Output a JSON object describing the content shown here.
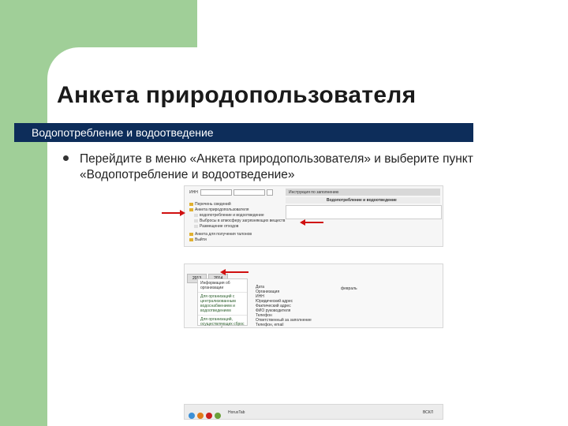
{
  "slide": {
    "title": "Анкета природопользователя",
    "section_bar": "Водопотребление и водоотведение",
    "bullet_text": "Перейдите в меню «Анкета природопользователя» и выберите пункт «Водопотребление и водоотведение»"
  },
  "screenshot_top": {
    "field_label": "ИНН",
    "instruction_link": "Инструкция по заполнению",
    "panel_header": "Водопотребление и водоотведение",
    "tree": [
      "Перечень сведений",
      "Анкета природопользователя",
      "водопотребление и водоотведение",
      "Выбросы в атмосферу загрязняющих веществ",
      "Размещение отходов",
      "Анкета для получения талонов",
      "Выйти"
    ]
  },
  "screenshot_bottom": {
    "tabs": [
      "2013",
      "2014"
    ],
    "left_items": [
      "Информация об организации",
      "Для организаций с централизованным водоснабжением и водоотведением",
      "Для организаций, осуществляющих сброс в водные объекты или на рельеф"
    ],
    "right_labels": [
      "Дата",
      "Организация",
      "ИНН",
      "Юридический адрес",
      "Фактический адрес",
      "ФИО руководителя",
      "Телефон",
      "Ответственный за заполнение",
      "Телефон, email"
    ],
    "period_label": "февраль"
  },
  "screenshot_taskbar": {
    "app_label": "HorusTab",
    "lang_label": "ВСКЛ"
  },
  "colors": {
    "background_green": "#a0cf98",
    "section_bar": "#0d2d5a",
    "arrow_red": "#d01010"
  }
}
